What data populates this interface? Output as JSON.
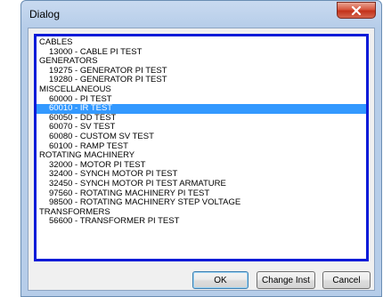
{
  "window": {
    "title": "Dialog",
    "close_icon": "close-icon",
    "colors": {
      "frame": "#b6cde9",
      "list_border": "#0a1bd8",
      "selection": "#3399ff",
      "close": "#c3321b"
    }
  },
  "list": {
    "rows": [
      {
        "text": "CABLES",
        "kind": "group",
        "selected": false
      },
      {
        "text": "13000 - CABLE PI TEST",
        "kind": "item",
        "selected": false
      },
      {
        "text": "GENERATORS",
        "kind": "group",
        "selected": false
      },
      {
        "text": "19275 - GENERATOR PI TEST",
        "kind": "item",
        "selected": false
      },
      {
        "text": "19280 - GENERATOR PI TEST",
        "kind": "item",
        "selected": false
      },
      {
        "text": "MISCELLANEOUS",
        "kind": "group",
        "selected": false
      },
      {
        "text": "60000 - PI TEST",
        "kind": "item",
        "selected": false
      },
      {
        "text": "60010 - IR TEST",
        "kind": "item",
        "selected": true
      },
      {
        "text": "60050 - DD TEST",
        "kind": "item",
        "selected": false
      },
      {
        "text": "60070 - SV TEST",
        "kind": "item",
        "selected": false
      },
      {
        "text": "60080 - CUSTOM SV TEST",
        "kind": "item",
        "selected": false
      },
      {
        "text": "60100 - RAMP TEST",
        "kind": "item",
        "selected": false
      },
      {
        "text": "ROTATING MACHINERY",
        "kind": "group",
        "selected": false
      },
      {
        "text": "32000 - MOTOR PI TEST",
        "kind": "item",
        "selected": false
      },
      {
        "text": "32400 - SYNCH MOTOR PI TEST",
        "kind": "item",
        "selected": false
      },
      {
        "text": "32450 - SYNCH MOTOR PI TEST ARMATURE",
        "kind": "item",
        "selected": false
      },
      {
        "text": "97560 - ROTATING MACHINERY PI TEST",
        "kind": "item",
        "selected": false
      },
      {
        "text": "98500 - ROTATING MACHINERY STEP VOLTAGE",
        "kind": "item",
        "selected": false
      },
      {
        "text": "TRANSFORMERS",
        "kind": "group",
        "selected": false
      },
      {
        "text": "56600 - TRANSFORMER PI TEST",
        "kind": "item",
        "selected": false
      }
    ]
  },
  "buttons": {
    "ok": "OK",
    "change_inst": "Change Inst",
    "cancel": "Cancel"
  }
}
